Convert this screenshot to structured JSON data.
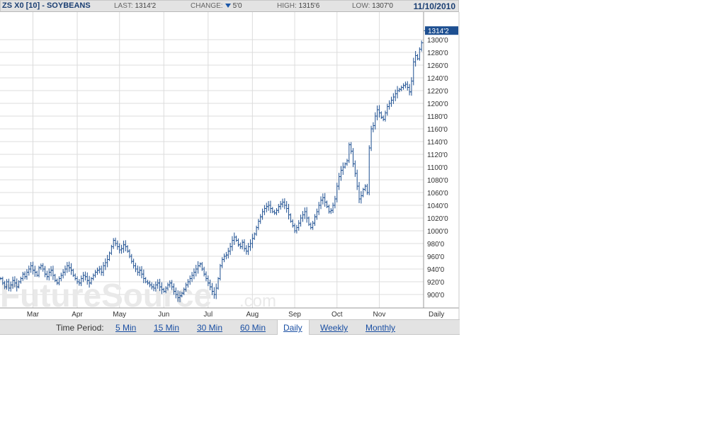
{
  "header": {
    "title": "ZS X0 [10] - SOYBEANS",
    "last_label": "LAST:",
    "last_value": "1314'2",
    "change_label": "CHANGE:",
    "change_value": "5'0",
    "high_label": "HIGH:",
    "high_value": "1315'6",
    "low_label": "LOW:",
    "low_value": "1307'0",
    "date": "11/10/2010"
  },
  "watermark": {
    "main": "FutureSource",
    "suffix": ".com"
  },
  "period_bar": {
    "label": "Time Period:",
    "options": [
      "5 Min",
      "15 Min",
      "30 Min",
      "60 Min",
      "Daily",
      "Weekly",
      "Monthly"
    ],
    "active": "Daily"
  },
  "colors": {
    "bars": "#1d4f91",
    "grid": "#dcdcdc",
    "header_bg": "#e3e3e3",
    "price_tag_bg": "#1d4f91"
  },
  "chart_data": {
    "type": "ohlc",
    "period": "Daily",
    "ylim": [
      880,
      1340
    ],
    "y_ticks": [
      900,
      920,
      940,
      960,
      980,
      1000,
      1020,
      1040,
      1060,
      1080,
      1100,
      1120,
      1140,
      1160,
      1180,
      1200,
      1220,
      1240,
      1260,
      1280,
      1300
    ],
    "y_tick_labels": [
      "900'0",
      "920'0",
      "940'0",
      "960'0",
      "980'0",
      "1000'0",
      "1020'0",
      "1040'0",
      "1060'0",
      "1080'0",
      "1100'0",
      "1120'0",
      "1140'0",
      "1160'0",
      "1180'0",
      "1200'0",
      "1220'0",
      "1240'0",
      "1260'0",
      "1280'0",
      "1300'0"
    ],
    "x_labels": [
      {
        "label": "Mar",
        "index": 16
      },
      {
        "label": "Apr",
        "index": 38
      },
      {
        "label": "May",
        "index": 59
      },
      {
        "label": "Jun",
        "index": 81
      },
      {
        "label": "Jul",
        "index": 103
      },
      {
        "label": "Aug",
        "index": 125
      },
      {
        "label": "Sep",
        "index": 146
      },
      {
        "label": "Oct",
        "index": 167
      },
      {
        "label": "Nov",
        "index": 188
      }
    ],
    "last_price_label": "1314'2",
    "last_price": 1314.25,
    "series": [
      {
        "name": "ZS X0",
        "close": [
          925,
          918,
          912,
          920,
          910,
          915,
          922,
          918,
          912,
          920,
          925,
          932,
          928,
          935,
          940,
          945,
          938,
          935,
          930,
          942,
          945,
          940,
          932,
          928,
          935,
          938,
          930,
          922,
          918,
          925,
          930,
          935,
          940,
          945,
          942,
          938,
          930,
          925,
          920,
          918,
          925,
          930,
          928,
          922,
          918,
          925,
          930,
          935,
          938,
          940,
          935,
          945,
          950,
          955,
          965,
          975,
          985,
          980,
          975,
          970,
          972,
          978,
          975,
          968,
          960,
          952,
          945,
          940,
          935,
          938,
          932,
          925,
          920,
          918,
          915,
          912,
          910,
          915,
          918,
          912,
          908,
          905,
          910,
          915,
          918,
          912,
          905,
          900,
          895,
          898,
          902,
          908,
          915,
          920,
          925,
          930,
          935,
          940,
          945,
          948,
          940,
          932,
          925,
          918,
          912,
          905,
          900,
          910,
          925,
          945,
          955,
          960,
          962,
          968,
          975,
          985,
          990,
          985,
          978,
          975,
          982,
          972,
          968,
          975,
          980,
          988,
          995,
          1005,
          1015,
          1022,
          1030,
          1035,
          1038,
          1040,
          1035,
          1030,
          1028,
          1032,
          1038,
          1042,
          1045,
          1040,
          1035,
          1025,
          1015,
          1008,
          1000,
          1005,
          1012,
          1020,
          1025,
          1030,
          1020,
          1010,
          1005,
          1012,
          1022,
          1030,
          1040,
          1048,
          1052,
          1045,
          1038,
          1030,
          1032,
          1040,
          1050,
          1070,
          1085,
          1095,
          1100,
          1105,
          1110,
          1135,
          1125,
          1105,
          1090,
          1070,
          1050,
          1055,
          1065,
          1070,
          1060,
          1130,
          1160,
          1165,
          1180,
          1190,
          1185,
          1178,
          1175,
          1185,
          1195,
          1200,
          1205,
          1210,
          1215,
          1220,
          1222,
          1225,
          1228,
          1230,
          1225,
          1218,
          1235,
          1265,
          1275,
          1270,
          1285,
          1295,
          1314
        ]
      }
    ]
  }
}
